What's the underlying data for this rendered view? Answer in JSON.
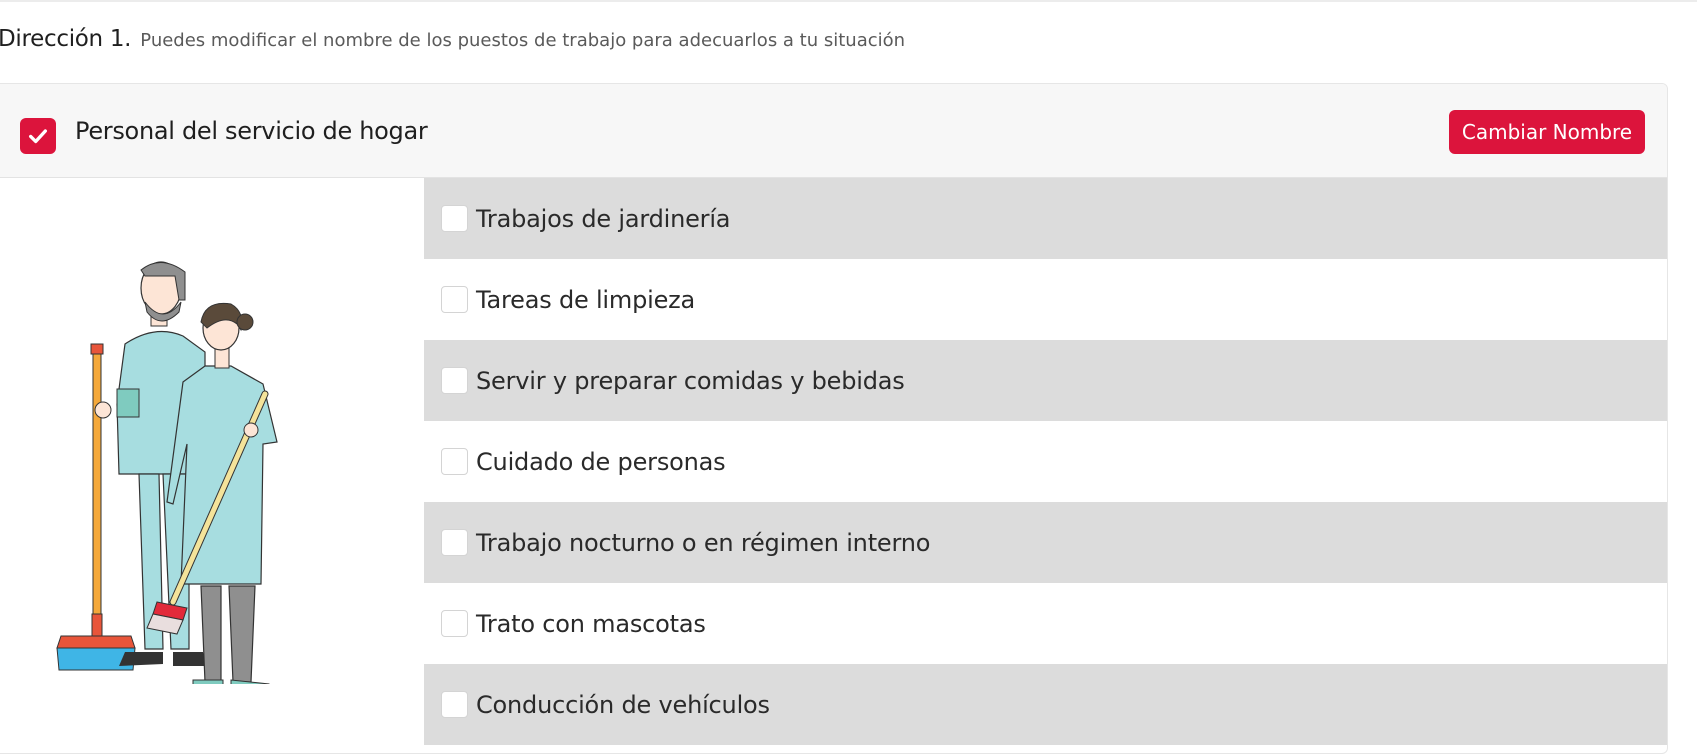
{
  "heading": {
    "title": "Dirección 1.",
    "subtitle": "Puedes modificar el nombre de los puestos de trabajo para adecuarlos a tu situación"
  },
  "group": {
    "title": "Personal del servicio de hogar",
    "checked": true,
    "rename_button_label": "Cambiar Nombre",
    "illustration": "domestic-service-workers-illustration",
    "check_icon": "check-icon"
  },
  "tasks": [
    {
      "label": "Trabajos de jardinería",
      "checked": false
    },
    {
      "label": "Tareas de limpieza",
      "checked": false
    },
    {
      "label": "Servir y preparar comidas y bebidas",
      "checked": false
    },
    {
      "label": "Cuidado de personas",
      "checked": false
    },
    {
      "label": "Trabajo nocturno o en régimen interno",
      "checked": false
    },
    {
      "label": "Trato con mascotas",
      "checked": false
    },
    {
      "label": "Conducción de vehículos",
      "checked": false
    }
  ],
  "colors": {
    "accent": "#dc143c",
    "row_shade": "#dcdcdc",
    "header_bg": "#f7f7f7"
  }
}
